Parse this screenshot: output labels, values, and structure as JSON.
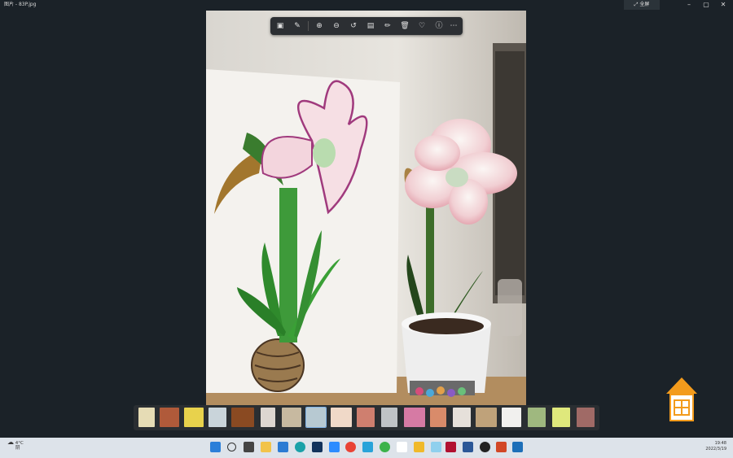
{
  "window": {
    "title": "图片 - 83P.jpg",
    "fullscreen_label": "全屏",
    "minimize": "–",
    "maximize": "▢",
    "close": "✕"
  },
  "toolbar": {
    "items": [
      "crop-icon",
      "edit-icon",
      "zoom-in-icon",
      "zoom-out-icon",
      "rotate-icon",
      "markup-icon",
      "draw-icon",
      "delete-icon",
      "favorite-icon",
      "info-icon",
      "more-icon"
    ]
  },
  "filmstrip": {
    "thumb_count": 20,
    "selected_index": 7
  },
  "taskbar": {
    "weather_temp": "4°C",
    "weather_desc": "阴",
    "time": "19:48",
    "date": "2022/3/19"
  }
}
